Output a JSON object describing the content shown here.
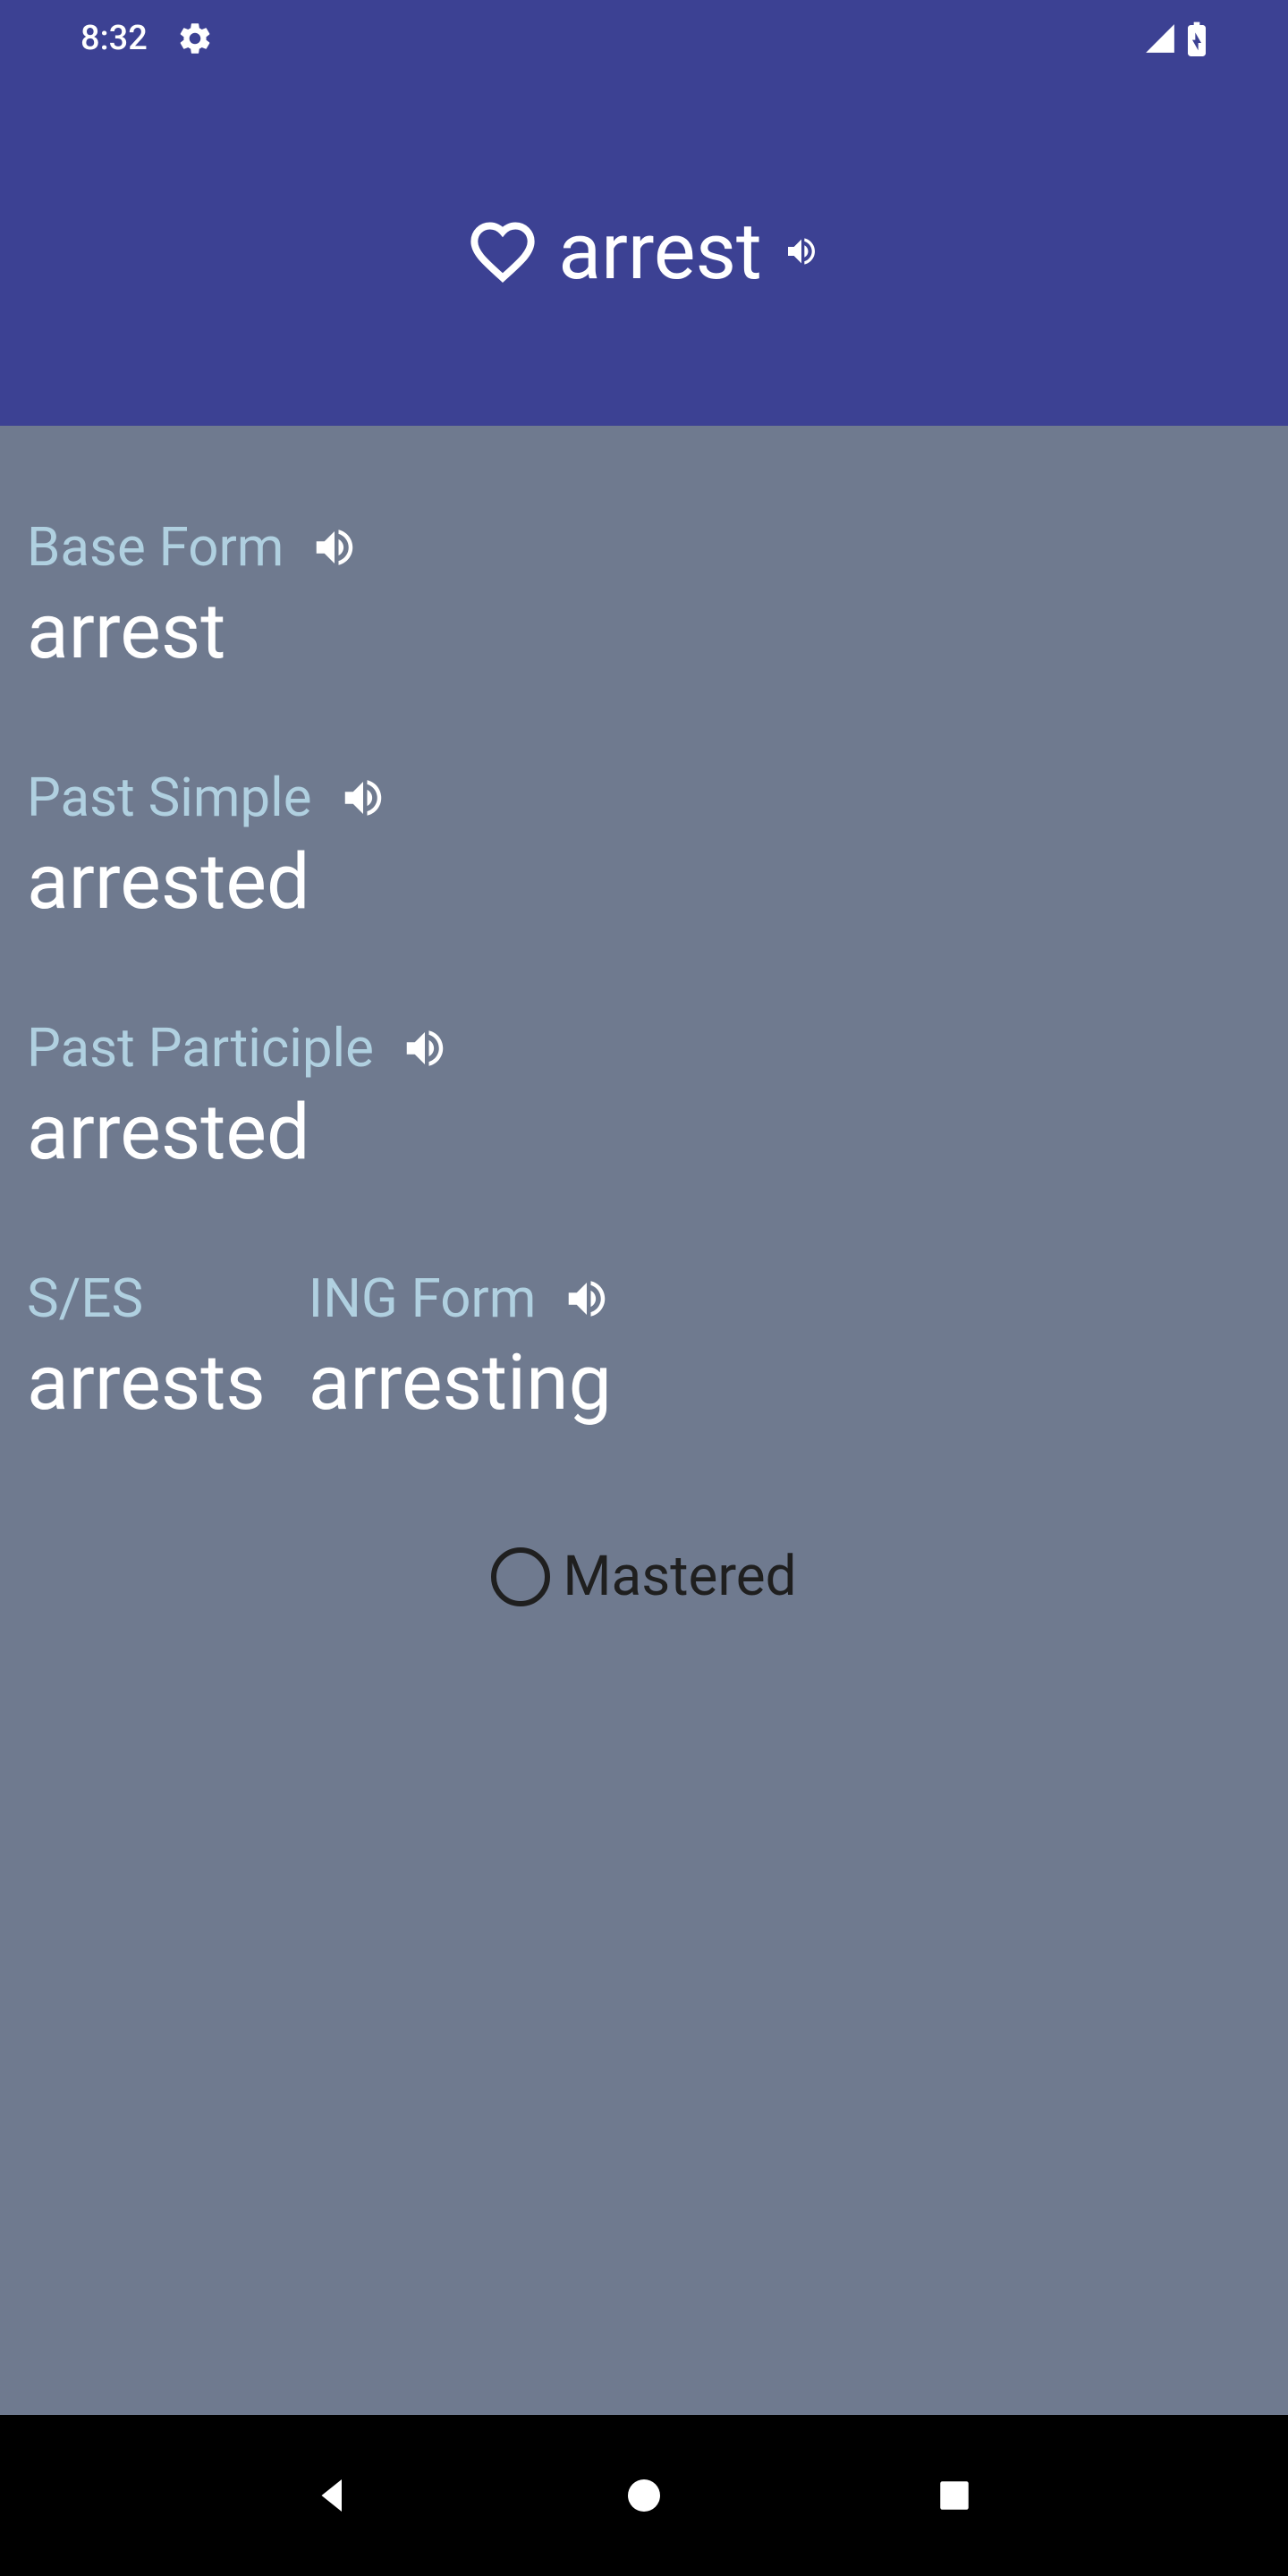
{
  "statusbar": {
    "time": "8:32"
  },
  "header": {
    "word": "arrest"
  },
  "forms": {
    "base": {
      "label": "Base Form",
      "value": "arrest"
    },
    "past_simple": {
      "label": "Past Simple",
      "value": "arrested"
    },
    "past_participle": {
      "label": "Past Participle",
      "value": "arrested"
    },
    "ses": {
      "label": "S/ES",
      "value": "arrests"
    },
    "ing": {
      "label": "ING Form",
      "value": "arresting"
    }
  },
  "mastered": {
    "label": "Mastered",
    "checked": false
  }
}
